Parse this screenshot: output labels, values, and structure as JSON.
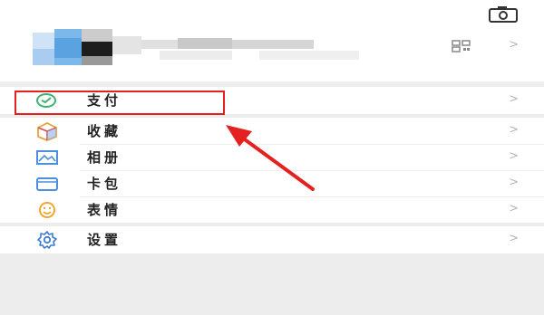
{
  "profile": {
    "camera_icon": "camera-icon",
    "qr_icon": "qr-code-icon",
    "chevron": ">"
  },
  "menu": {
    "pay": {
      "label": "支付",
      "icon": "wechat-pay-icon"
    },
    "favorites": {
      "label": "收藏",
      "icon": "favorites-cube-icon"
    },
    "album": {
      "label": "相册",
      "icon": "album-icon"
    },
    "cards": {
      "label": "卡包",
      "icon": "card-wallet-icon"
    },
    "stickers": {
      "label": "表情",
      "icon": "emoji-icon"
    },
    "settings": {
      "label": "设置",
      "icon": "gear-icon"
    }
  },
  "chevron": ">",
  "colors": {
    "highlight": "#e5211f",
    "pay_green": "#3cb371",
    "settings_blue": "#3a7bd5"
  }
}
